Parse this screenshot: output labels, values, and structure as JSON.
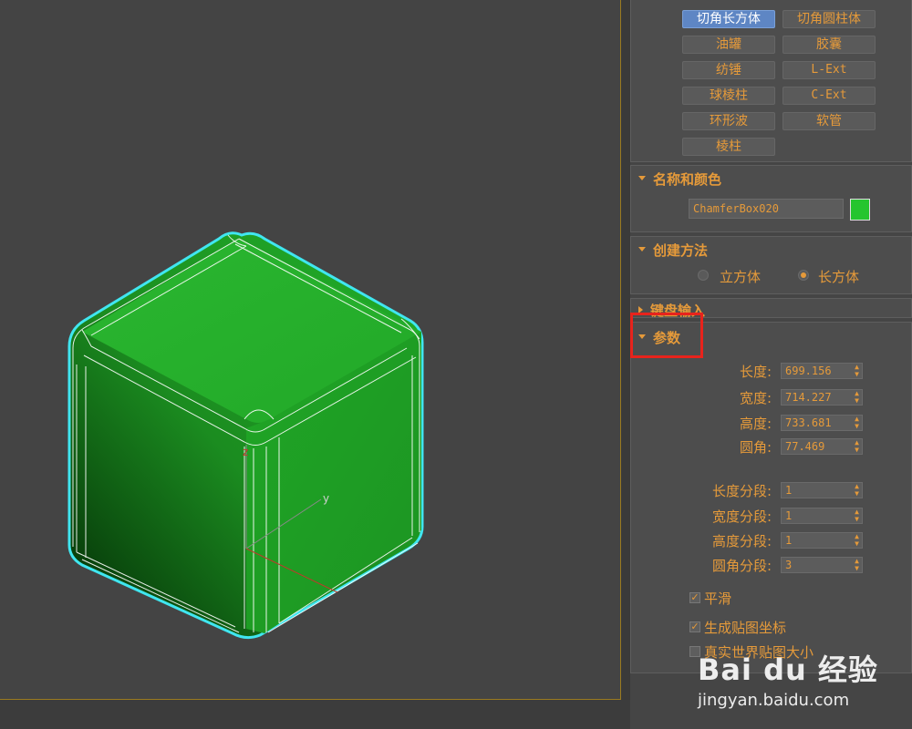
{
  "shapes_rollout": {
    "buttons": [
      {
        "label": "切角长方体",
        "active": true
      },
      {
        "label": "切角圆柱体",
        "active": false
      },
      {
        "label": "油罐",
        "active": false
      },
      {
        "label": "胶囊",
        "active": false
      },
      {
        "label": "纺锤",
        "active": false
      },
      {
        "label": "L-Ext",
        "active": false
      },
      {
        "label": "球棱柱",
        "active": false
      },
      {
        "label": "C-Ext",
        "active": false
      },
      {
        "label": "环形波",
        "active": false
      },
      {
        "label": "软管",
        "active": false
      },
      {
        "label": "棱柱",
        "active": false
      }
    ]
  },
  "name_color": {
    "title": "名称和颜色",
    "object_name": "ChamferBox020",
    "color": "#25c52f"
  },
  "creation_method": {
    "title": "创建方法",
    "options": [
      {
        "label": "立方体",
        "selected": false
      },
      {
        "label": "长方体",
        "selected": true
      }
    ]
  },
  "keyboard_entry": {
    "title": "键盘输入"
  },
  "parameters": {
    "title": "参数",
    "fields": [
      {
        "label": "长度:",
        "value": "699.156"
      },
      {
        "label": "宽度:",
        "value": "714.227"
      },
      {
        "label": "高度:",
        "value": "733.681"
      },
      {
        "label": "圆角:",
        "value": "77.469"
      }
    ],
    "segments": [
      {
        "label": "长度分段:",
        "value": "1"
      },
      {
        "label": "宽度分段:",
        "value": "1"
      },
      {
        "label": "高度分段:",
        "value": "1"
      },
      {
        "label": "圆角分段:",
        "value": "3"
      }
    ],
    "checkboxes": [
      {
        "label": "平滑",
        "checked": true
      },
      {
        "label": "生成贴图坐标",
        "checked": true
      },
      {
        "label": "真实世界贴图大小",
        "checked": false
      }
    ]
  },
  "viewport": {
    "axis_y_label": "y",
    "axis_z_label": "z",
    "object_color": "#25c52f",
    "selection_color": "#40e6f0"
  },
  "watermark": {
    "logo": "Bai du 经验",
    "url": "jingyan.baidu.com"
  },
  "colors": {
    "accent_text": "#e59a3a",
    "active_button": "#5e86c4",
    "highlight_box": "#e8231c"
  }
}
